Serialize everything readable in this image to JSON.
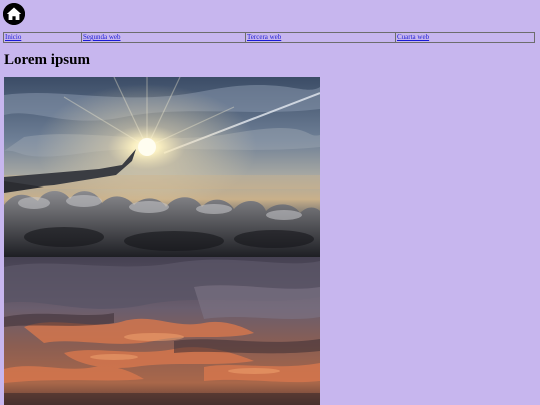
{
  "logo": {
    "icon": "home-icon"
  },
  "nav": {
    "items": [
      {
        "label": "Inicio"
      },
      {
        "label": "Segunda web"
      },
      {
        "label": "Tercera web"
      },
      {
        "label": "Cuarta web"
      }
    ]
  },
  "main": {
    "title": "Lorem ipsum"
  },
  "colors": {
    "background": "#c7b6ee",
    "link": "#1a1ad6"
  }
}
